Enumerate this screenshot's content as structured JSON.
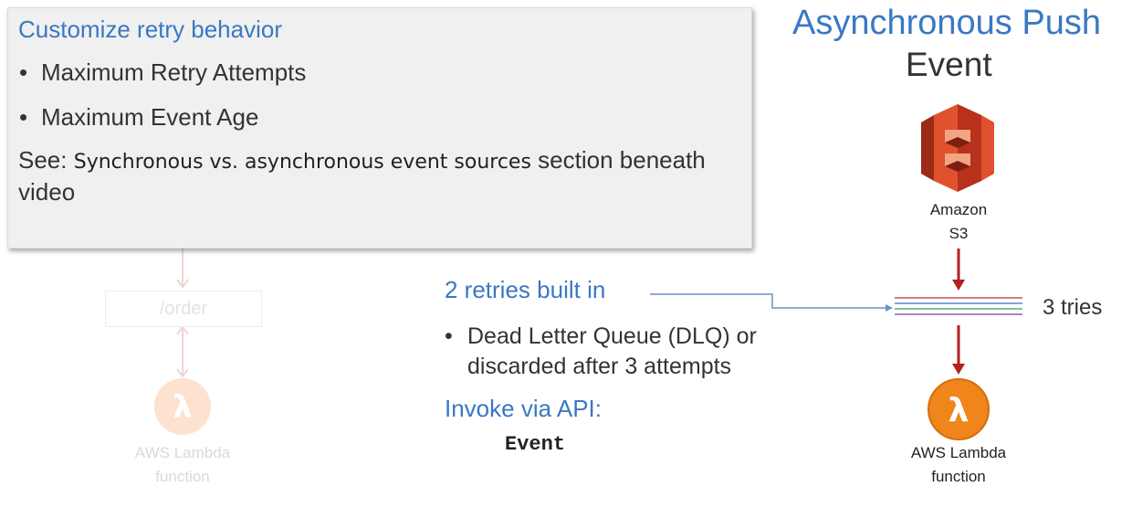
{
  "callout": {
    "title": "Customize retry behavior",
    "bullets": [
      "Maximum Retry Attempts",
      "Maximum Event Age"
    ],
    "see_prefix": "See:",
    "see_link": "Synchronous vs. asynchronous event sources",
    "see_suffix": "section beneath video"
  },
  "background_diagram": {
    "order_label": "/order",
    "lambda_label_line1": "AWS Lambda",
    "lambda_label_line2": "function"
  },
  "heading": {
    "title": "Asynchronous Push",
    "subtitle": "Event"
  },
  "s3": {
    "label_line1": "Amazon",
    "label_line2": "S3"
  },
  "retries": {
    "title": "2 retries built in",
    "bullet": "Dead Letter Queue (DLQ) or discarded after 3 attempts",
    "tries_label": "3 tries"
  },
  "invoke": {
    "title": "Invoke via API:",
    "code": "Event"
  },
  "lambda": {
    "label_line1": "AWS Lambda",
    "label_line2": "function"
  },
  "colors": {
    "accent_blue": "#3a78c3",
    "arrow_red": "#b32020",
    "s3_orange": "#d9492b",
    "lambda_orange": "#f0851c"
  },
  "icons": [
    "amazon-s3-icon",
    "aws-lambda-icon",
    "down-arrow-icon",
    "lambda-icon-faded"
  ]
}
